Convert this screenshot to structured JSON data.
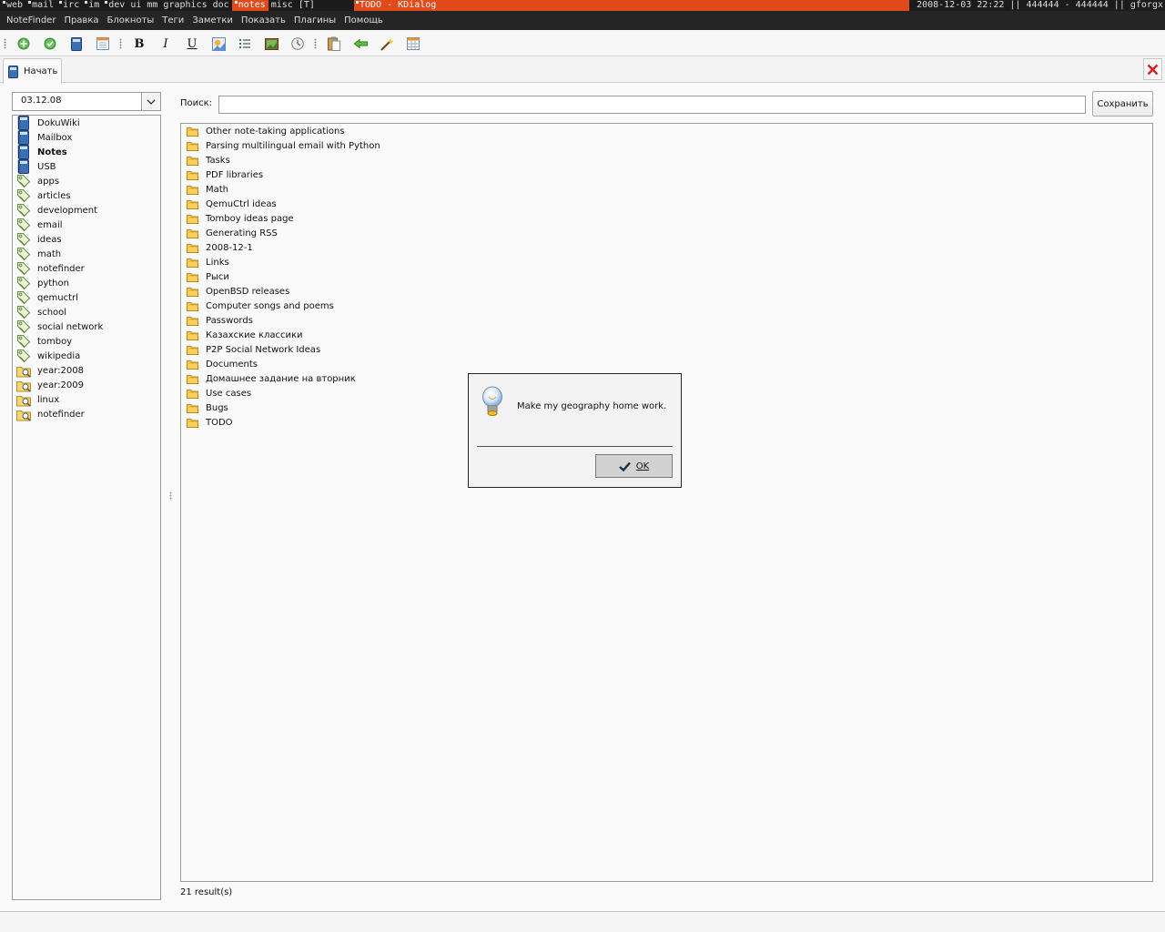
{
  "wm_bar": {
    "tags": [
      "web",
      "mail",
      "irc",
      "im",
      "dev",
      "ui",
      "mm",
      "graphics",
      "doc",
      "notes",
      "misc",
      "[T]"
    ],
    "marked_tags": [
      "web",
      "mail",
      "irc",
      "im",
      "dev",
      "notes"
    ],
    "active_tag": "notes",
    "window_title": "TODO - KDialog",
    "status": "2008-12-03 22:22 || 444444 - 444444 || gforgx",
    "accent_color": "#e24a1a"
  },
  "menubar": {
    "items": [
      "NoteFinder",
      "Правка",
      "Блокноты",
      "Теги",
      "Заметки",
      "Показать",
      "Плагины",
      "Помощь"
    ]
  },
  "toolbar": {
    "buttons": [
      "new-note-icon",
      "apply-icon",
      "notebook-icon",
      "calendar-icon",
      "bold-icon",
      "italic-icon",
      "underline-icon",
      "image-icon",
      "bullet-list-icon",
      "picture-icon",
      "clock-icon",
      "paste-icon",
      "back-arrow-icon",
      "magic-wand-icon",
      "table-icon"
    ],
    "bold_glyph": "B",
    "italic_glyph": "I",
    "underline_glyph": "U"
  },
  "tabs": {
    "start_label": "Начать"
  },
  "sidebar": {
    "date_value": "03.12.08",
    "notebooks": [
      {
        "label": "DokuWiki",
        "bold": false
      },
      {
        "label": "Mailbox",
        "bold": false
      },
      {
        "label": "Notes",
        "bold": true
      },
      {
        "label": "USB",
        "bold": false
      }
    ],
    "tags": [
      "apps",
      "articles",
      "development",
      "email",
      "ideas",
      "math",
      "notefinder",
      "python",
      "qemuctrl",
      "school",
      "social network",
      "tomboy",
      "wikipedia"
    ],
    "saved_searches": [
      "year:2008",
      "year:2009",
      "linux",
      "notefinder"
    ]
  },
  "search": {
    "label": "Поиск:",
    "value": "",
    "save_label": "Сохранить"
  },
  "results": {
    "notes": [
      "Other note-taking applications",
      "Parsing multilingual email with Python",
      "Tasks",
      "PDF libraries",
      "Math",
      "QemuCtrl ideas",
      "Tomboy ideas page",
      "Generating RSS",
      "2008-12-1",
      "Links",
      "Рыси",
      "OpenBSD releases",
      "Computer songs and poems",
      "Passwords",
      "Казахские классики",
      "P2P Social Network Ideas",
      "Documents",
      "Домашнее задание на вторник",
      "Use cases",
      "Bugs",
      "TODO"
    ],
    "count_text": "21 result(s)"
  },
  "dialog": {
    "message": "Make my geography home work.",
    "ok_label": "OK"
  }
}
